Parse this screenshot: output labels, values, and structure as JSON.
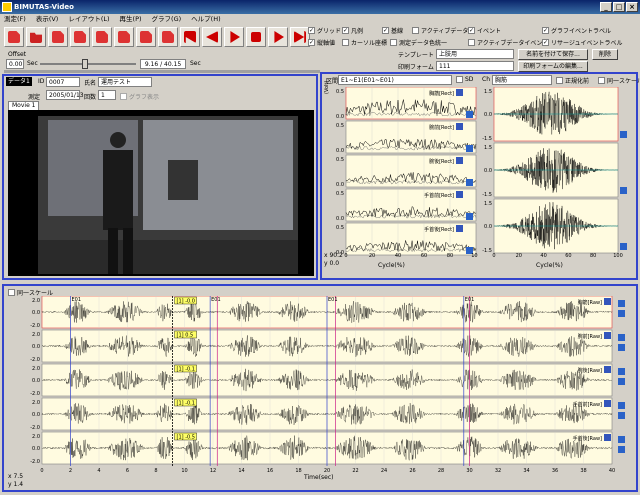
{
  "window": {
    "title": "BIMUTAS-Video",
    "min": "_",
    "max": "□",
    "close": "×"
  },
  "menu": [
    "測定(F)",
    "表示(V)",
    "レイアウト(L)",
    "再生(P)",
    "グラフ(G)",
    "ヘルプ(H)"
  ],
  "options": {
    "grid": "グリッド",
    "legend": "凡例",
    "base": "基線",
    "active_data": "アクティブデータ",
    "event": "イベント",
    "graph_event_label": "グラフイベントラベル",
    "vertical_axis": "縦軸値",
    "cursor_coord": "カーソル座標",
    "meas_color": "測定データ色統一",
    "active_event": "アクティブデータイベント",
    "lissajous_label": "リサージュイベントラベル"
  },
  "template": {
    "label": "テンプレート",
    "value": "上肢用",
    "save_as": "名前を付けて保存...",
    "delete": "削除"
  },
  "print": {
    "label": "印刷フォーム",
    "value": "111",
    "edit": "印刷フォームの編集..."
  },
  "offset": {
    "label": "Offset",
    "value": "0.00",
    "unit": "Sec",
    "time": "9.16 / 40.15",
    "time_unit": "Sec"
  },
  "data_panel": {
    "tab": "データ1",
    "id_label": "ID",
    "id": "0007",
    "name_label": "氏名",
    "name": "運用テスト",
    "date_label": "測定",
    "date": "2005/01/13",
    "count_label": "回数",
    "count": "1",
    "graph_show": "グラフ表示",
    "movie_tab": "Movie 1"
  },
  "section_panel": {
    "label": "区間",
    "value": "E1~E1(E01~E01)",
    "sd": "SD",
    "ch_label": "Ch",
    "ch_value": "胸筋",
    "normalize": "正規化前",
    "same_scale": "同一スケール",
    "tags": [
      "胸筋[Rect]",
      "腕前[Rect]",
      "腕後[Rect]",
      "手首前[Rect]",
      "手首後[Rect]"
    ],
    "yaxis": "(Volt)",
    "xlabel": "Cycle(%)",
    "x": "90.2",
    "y": "0.0",
    "x_label": "x",
    "y_label": "y",
    "yticks": [
      "0.5",
      "0.0",
      "0.5",
      "0.0",
      "0.5",
      "0.0",
      "0.5",
      "0.0",
      "0.5",
      "0.0"
    ],
    "xticks": [
      "0",
      "20",
      "40",
      "60",
      "80",
      "100"
    ],
    "rticks": [
      "1.5",
      "0.0",
      "-1.5"
    ]
  },
  "main_panel": {
    "same_scale": "同一スケール",
    "yaxis": "(Volt)",
    "xlabel": "Time(sec)",
    "x": "7.5",
    "y": "1.4",
    "x_label": "x",
    "y_label": "y",
    "tags": [
      "胸筋[Raw]",
      "腕前[Raw]",
      "腕後[Raw]",
      "手首前[Raw]",
      "手首後[Raw]"
    ],
    "cursor_values": [
      "-0.0",
      "0.5",
      "-0.1",
      "-0.1",
      "-0.5"
    ],
    "cursor_index": "1",
    "event_label": "E01",
    "yticks": [
      "2.0",
      "0.0",
      "-2.0"
    ],
    "xticks": [
      "0",
      "2",
      "4",
      "6",
      "8",
      "10",
      "12",
      "14",
      "16",
      "18",
      "20",
      "22",
      "24",
      "26",
      "28",
      "30",
      "32",
      "34",
      "36",
      "38",
      "40"
    ]
  }
}
